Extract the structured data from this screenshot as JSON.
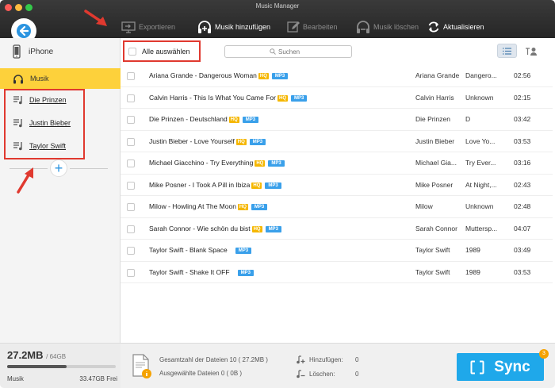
{
  "window": {
    "title": "Music Manager"
  },
  "toolbar": {
    "export_label": "Exportieren",
    "add_music_label": "Musik hinzufügen",
    "edit_label": "Bearbeiten",
    "delete_music_label": "Musik löschen",
    "refresh_label": "Aktualisieren"
  },
  "sidebar": {
    "device_name": "iPhone",
    "music_label": "Musik",
    "playlists": [
      {
        "label": "Die Prinzen"
      },
      {
        "label": "Justin Bieber"
      },
      {
        "label": "Taylor Swift"
      }
    ],
    "storage": {
      "used": "27.2MB",
      "total": "/ 64GB",
      "label": "Musik",
      "free": "33.47GB Frei",
      "used_fraction": 0.55
    }
  },
  "main": {
    "select_all_label": "Alle auswählen",
    "search_placeholder": "Suchen",
    "tracks": [
      {
        "title": "Ariana Grande - Dangerous Woman",
        "hq": "HQ",
        "format": "MP3",
        "artist": "Ariana Grande",
        "album": "Dangero...",
        "duration": "02:56"
      },
      {
        "title": "Calvin Harris - This Is What You Came For",
        "hq": "HQ",
        "format": "MP3",
        "artist": "Calvin Harris",
        "album": "Unknown",
        "duration": "02:15"
      },
      {
        "title": "Die Prinzen - Deutschland",
        "hq": "HQ",
        "format": "MP3",
        "artist": "Die Prinzen",
        "album": "D",
        "duration": "03:42"
      },
      {
        "title": "Justin Bieber - Love Yourself",
        "hq": "HQ",
        "format": "MP3",
        "artist": "Justin Bieber",
        "album": "Love Yo...",
        "duration": "03:53"
      },
      {
        "title": "Michael Giacchino - Try Everything",
        "hq": "HQ",
        "format": "MP3",
        "artist": "Michael Gia...",
        "album": "Try Ever...",
        "duration": "03:16"
      },
      {
        "title": "Mike Posner - I Took A Pill in Ibiza",
        "hq": "HQ",
        "format": "MP3",
        "artist": "Mike Posner",
        "album": "At Night,...",
        "duration": "02:43"
      },
      {
        "title": "Milow - Howling At The Moon",
        "hq": "HQ",
        "format": "MP3",
        "artist": "Milow",
        "album": "Unknown",
        "duration": "02:48"
      },
      {
        "title": "Sarah Connor - Wie schön du bist",
        "hq": "HQ",
        "format": "MP3",
        "artist": "Sarah Connor",
        "album": "Muttersp...",
        "duration": "04:07"
      },
      {
        "title": "Taylor Swift - Blank Space",
        "hq": "",
        "format": "MP3",
        "artist": "Taylor Swift",
        "album": "1989",
        "duration": "03:49"
      },
      {
        "title": "Taylor Swift - Shake It OFF",
        "hq": "",
        "format": "MP3",
        "artist": "Taylor Swift",
        "album": "1989",
        "duration": "03:53"
      }
    ]
  },
  "status": {
    "total_files": "Gesamtzahl der Dateien 10 ( 27.2MB )",
    "selected_files": "Ausgewählte Dateien 0 ( 0B )",
    "add_label": "Hinzufügen:",
    "add_count": "0",
    "delete_label": "Löschen:",
    "delete_count": "0",
    "sync_label": "Sync",
    "sync_badge": "3"
  },
  "colors": {
    "accent": "#1fa8ea",
    "sidebar_active": "#fdd13b",
    "annotation": "#e0392f",
    "hq_badge": "#f5b700",
    "mp3_badge": "#3aa0ea"
  }
}
